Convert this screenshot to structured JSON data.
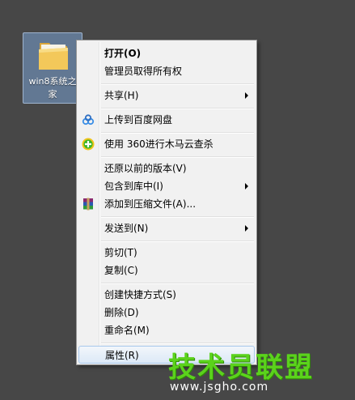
{
  "desktop": {
    "folder_label": "win8系统之家"
  },
  "menu": {
    "items": [
      {
        "label": "打开(O)",
        "bold": true
      },
      {
        "label": "管理员取得所有权"
      },
      {
        "label": "共享(H)",
        "submenu": true
      },
      {
        "label": "上传到百度网盘",
        "icon": "baidu-cloud-icon"
      },
      {
        "label": "使用 360进行木马云查杀",
        "icon": "360-security-icon"
      },
      {
        "label": "还原以前的版本(V)"
      },
      {
        "label": "包含到库中(I)",
        "submenu": true
      },
      {
        "label": "添加到压缩文件(A)...",
        "icon": "winrar-icon"
      },
      {
        "label": "发送到(N)",
        "submenu": true
      },
      {
        "label": "剪切(T)"
      },
      {
        "label": "复制(C)"
      },
      {
        "label": "创建快捷方式(S)"
      },
      {
        "label": "删除(D)"
      },
      {
        "label": "重命名(M)"
      },
      {
        "label": "属性(R)",
        "hovered": true
      }
    ]
  },
  "watermark": {
    "title": "技术员联盟",
    "url": "www.jsgho.com"
  },
  "colors": {
    "desktop_bg": "#474747",
    "menu_bg": "#f1f1f1",
    "watermark_green": "#5bd21c"
  }
}
